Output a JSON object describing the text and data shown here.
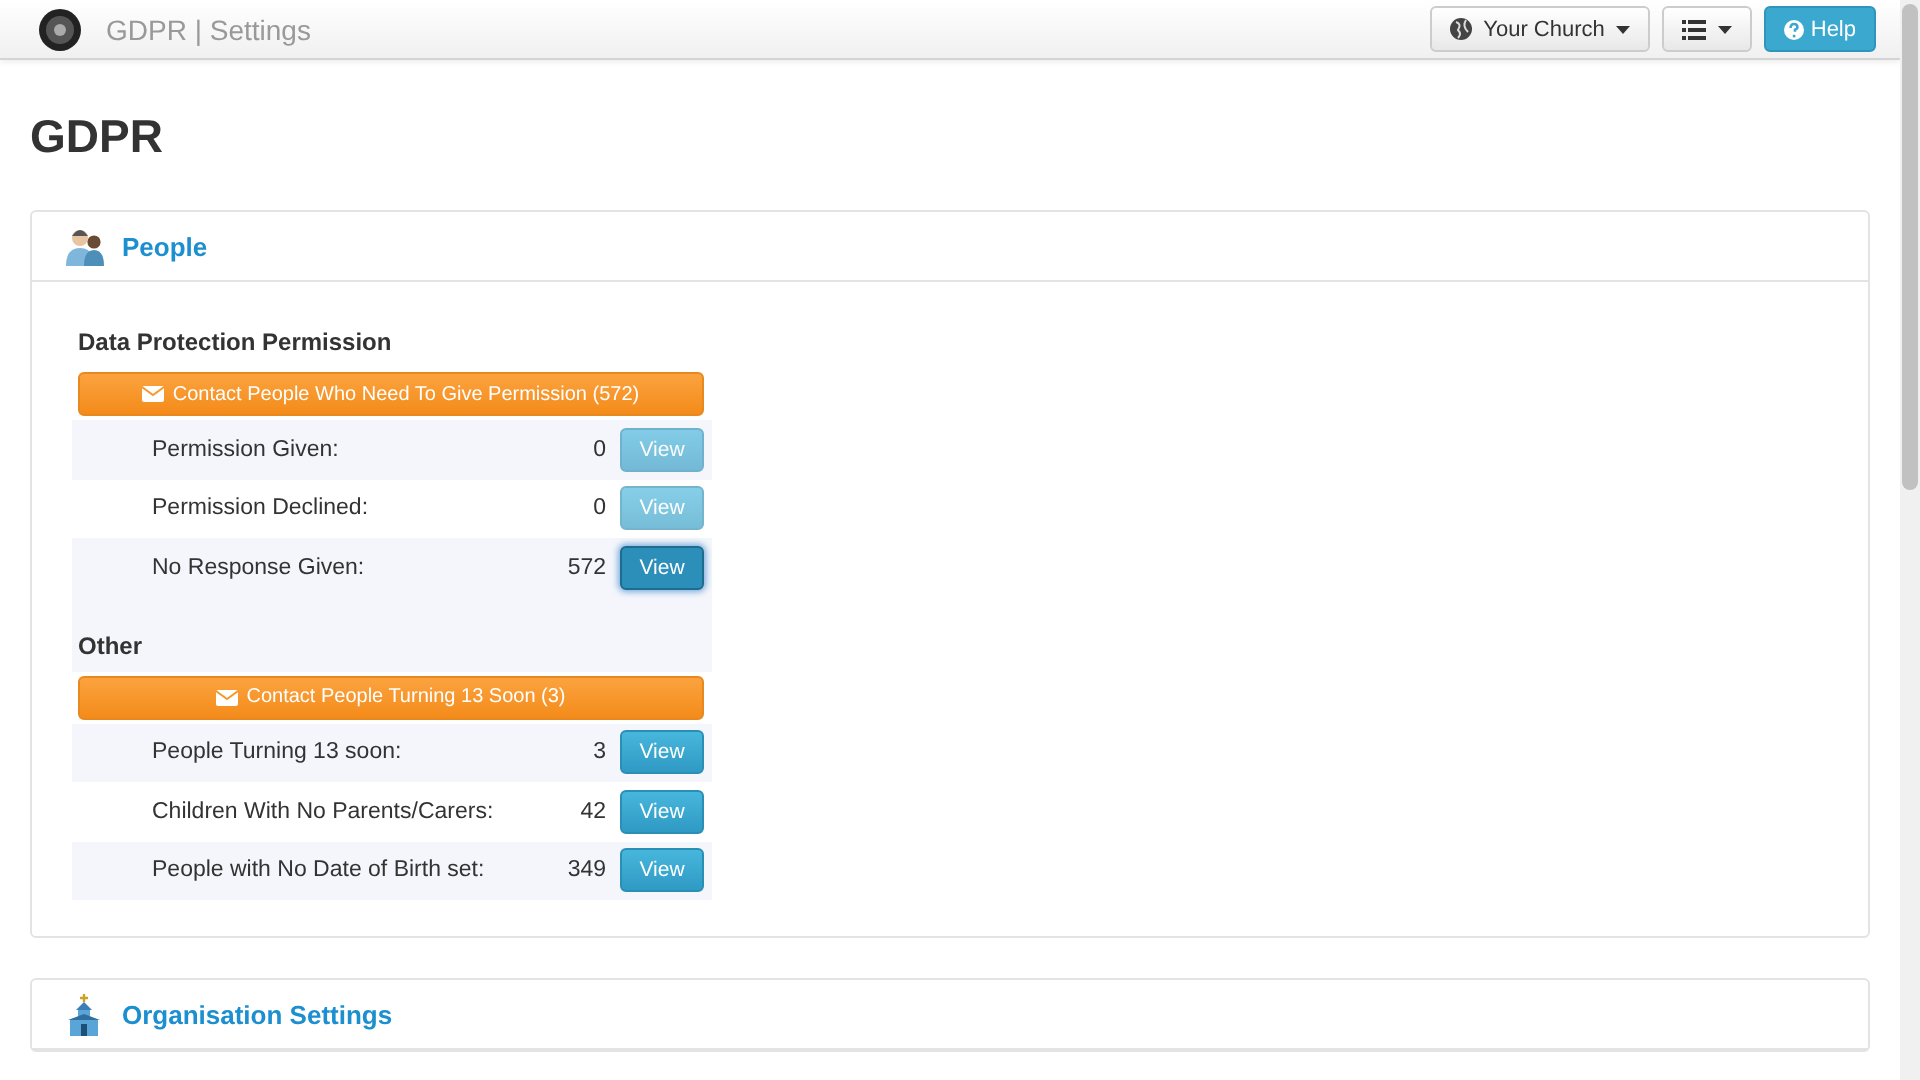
{
  "navbar": {
    "title": "GDPR | Settings",
    "church_button": "Your Church",
    "help_button": "Help"
  },
  "page_title": "GDPR",
  "panels": [
    {
      "title": "People",
      "groups": [
        {
          "heading": "Data Protection Permission",
          "action": "Contact People Who Need To Give Permission (572)",
          "rows": [
            {
              "label": "Permission Given:",
              "count": "0",
              "button": "View",
              "disabled": true,
              "focused": false
            },
            {
              "label": "Permission Declined:",
              "count": "0",
              "button": "View",
              "disabled": true,
              "focused": false
            },
            {
              "label": "No Response Given:",
              "count": "572",
              "button": "View",
              "disabled": false,
              "focused": true
            }
          ]
        },
        {
          "heading": "Other",
          "action": "Contact People Turning 13 Soon (3)",
          "rows": [
            {
              "label": "People Turning 13 soon:",
              "count": "3",
              "button": "View",
              "disabled": false,
              "focused": false
            },
            {
              "label": "Children With No Parents/Carers:",
              "count": "42",
              "button": "View",
              "disabled": false,
              "focused": false
            },
            {
              "label": "People with No Date of Birth set:",
              "count": "349",
              "button": "View",
              "disabled": false,
              "focused": false
            }
          ]
        }
      ]
    },
    {
      "title": "Organisation Settings"
    }
  ]
}
